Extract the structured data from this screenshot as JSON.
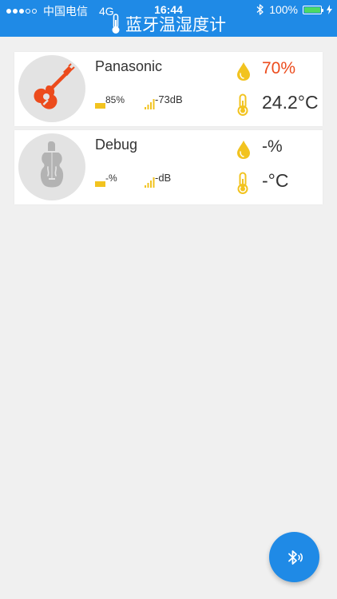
{
  "status_bar": {
    "carrier": "中国电信",
    "network": "4G",
    "time": "16:44",
    "battery_percent": "100%",
    "icons": [
      "signal-dots-icon",
      "bluetooth-icon",
      "battery-icon",
      "charging-icon"
    ]
  },
  "nav": {
    "title": "蓝牙温湿度计",
    "icon": "thermometer-icon"
  },
  "devices": [
    {
      "name": "Panasonic",
      "battery": "85%",
      "signal": "-73dB",
      "humidity": "70%",
      "temperature": "24.2°C",
      "avatar_icon": "guitar-icon",
      "humidity_color": "#ec4b1c"
    },
    {
      "name": "Debug",
      "battery": "-%",
      "signal": "-dB",
      "humidity": "-%",
      "temperature": "-°C",
      "avatar_icon": "violin-icon",
      "humidity_color": "#333333"
    }
  ],
  "fab": {
    "icon": "bluetooth-scan-icon"
  },
  "colors": {
    "primary": "#1f8ae6",
    "background": "#f0f0f0",
    "accent": "#ec4b1c",
    "indicator": "#f2c31f",
    "avatar_bg": "#e3e3e3"
  }
}
